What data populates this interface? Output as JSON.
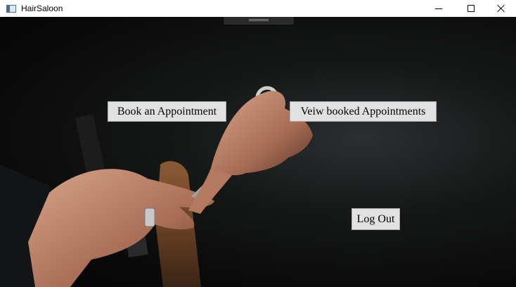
{
  "window": {
    "title": "HairSaloon",
    "icon": "app-window-icon",
    "controls": [
      "minimize-icon",
      "maximize-icon",
      "close-icon"
    ]
  },
  "main": {
    "background": "hair-salon-photo",
    "buttons": {
      "book": "Book an Appointment",
      "view": "Veiw booked Appointments",
      "logout": "Log Out"
    }
  },
  "colors": {
    "button_bg": "#e1e1e1",
    "button_border": "#adadad",
    "background_dark": "#0b0b0b"
  }
}
